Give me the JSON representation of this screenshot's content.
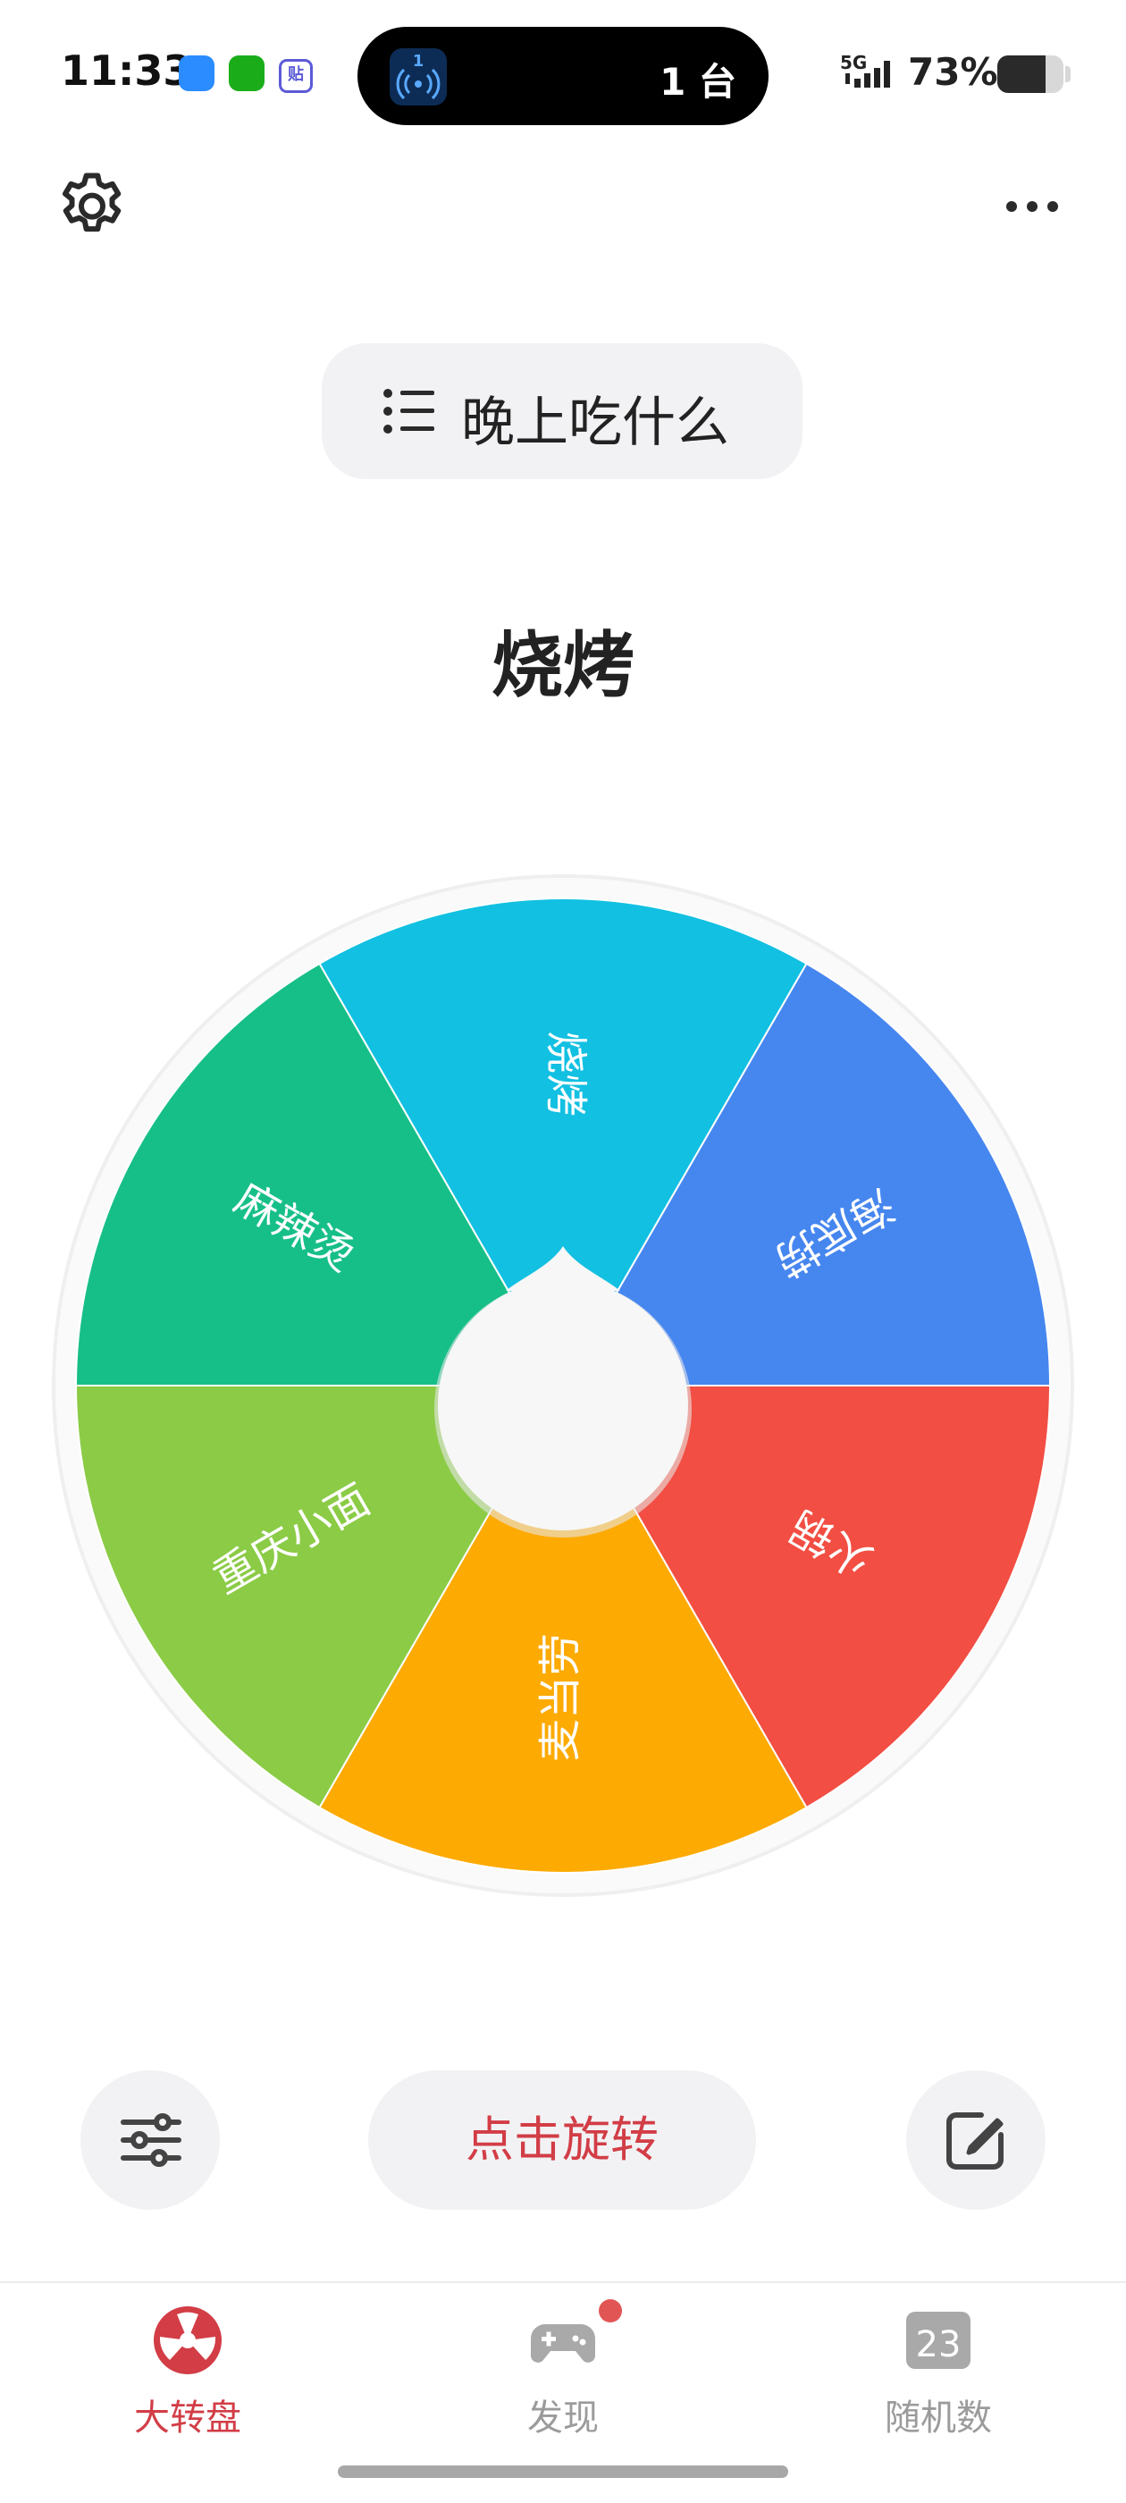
{
  "status_bar": {
    "time": "11:33",
    "island_count": "1 台",
    "island_app_number": "1",
    "network": "5G",
    "battery_percent": "73%",
    "battery_level": 0.73,
    "notification_icon_label": "贴"
  },
  "header": {
    "list_title": "晚上吃什么"
  },
  "result": "烧烤",
  "wheel": {
    "segments": [
      {
        "label": "烧烤",
        "color": "#12C0E2"
      },
      {
        "label": "海底捞",
        "color": "#4686EF"
      },
      {
        "label": "火锅",
        "color": "#F24E43"
      },
      {
        "label": "麦当劳",
        "color": "#FDAA02"
      },
      {
        "label": "重庆小面",
        "color": "#8BCB46"
      },
      {
        "label": "麻辣烫",
        "color": "#17BF88"
      }
    ]
  },
  "controls": {
    "spin_label": "点击旋转"
  },
  "tabs": [
    {
      "label": "大转盘",
      "active": true
    },
    {
      "label": "发现",
      "active": false,
      "has_badge": true
    },
    {
      "label": "随机数",
      "active": false,
      "icon_text": "23"
    }
  ],
  "colors": {
    "accent": "#D23D46",
    "pill_bg": "#F2F2F4"
  }
}
